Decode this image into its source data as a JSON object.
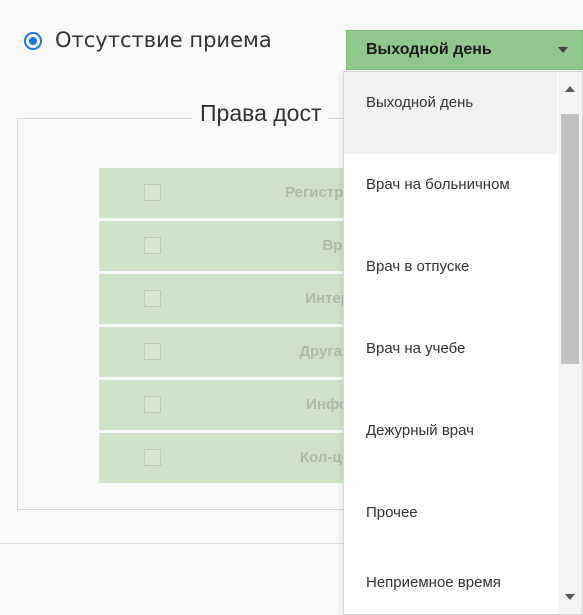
{
  "absence": {
    "radio_label": "Отсутствие приема",
    "selected": true
  },
  "reason_select": {
    "value": "Выходной день",
    "accent_color": "#8fc88a"
  },
  "permissions": {
    "legend": "Права дост",
    "rows": [
      {
        "label": "Регистрат",
        "checked": false
      },
      {
        "label": "Врач",
        "checked": false
      },
      {
        "label": "Интерн",
        "checked": false
      },
      {
        "label": "Другая I",
        "checked": false
      },
      {
        "label": "Инфом",
        "checked": false
      },
      {
        "label": "Кол-цен",
        "checked": false
      }
    ]
  },
  "dropdown": {
    "options": [
      {
        "label": "Выходной день"
      },
      {
        "label": "Врач на больничном"
      },
      {
        "label": "Врач в отпуске"
      },
      {
        "label": "Врач на учебе"
      },
      {
        "label": "Дежурный врач"
      },
      {
        "label": "Прочее"
      },
      {
        "label": "Неприемное время"
      }
    ]
  }
}
